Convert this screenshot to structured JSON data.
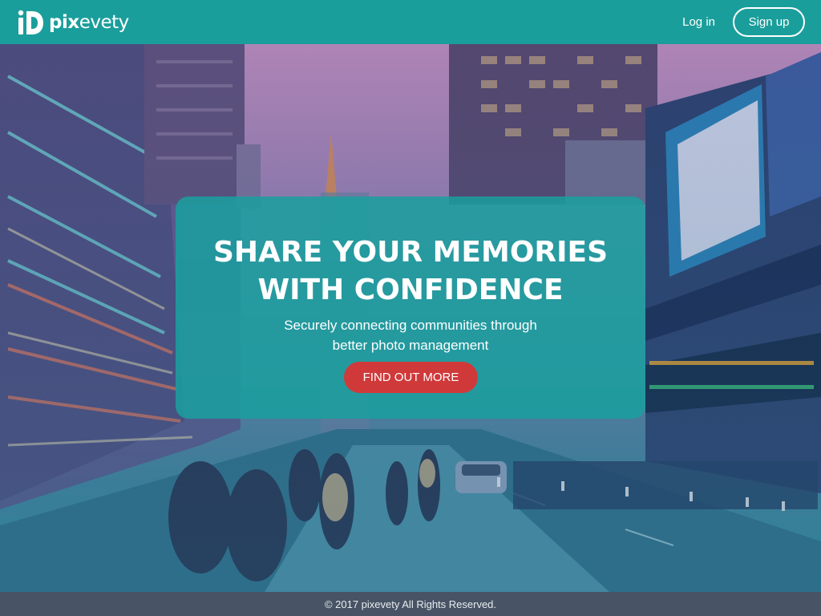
{
  "header": {
    "brand_prefix": "pix",
    "brand_suffix": "evety",
    "login_label": "Log in",
    "signup_label": "Sign up"
  },
  "hero": {
    "title_line1": "SHARE YOUR MEMORIES",
    "title_line2": "WITH CONFIDENCE",
    "subtitle_line1": "Securely connecting communities through",
    "subtitle_line2": "better photo management",
    "cta_label": "FIND OUT MORE"
  },
  "footer": {
    "copyright": "© 2017 pixevety All Rights Reserved."
  },
  "icons": {
    "logo": "pixevety-logo-icon"
  },
  "colors": {
    "header_bg": "#1a9e9b",
    "card_bg": "#1aa09e",
    "cta_bg": "#d0393a",
    "footer_bg": "#485465",
    "text": "#ffffff"
  }
}
